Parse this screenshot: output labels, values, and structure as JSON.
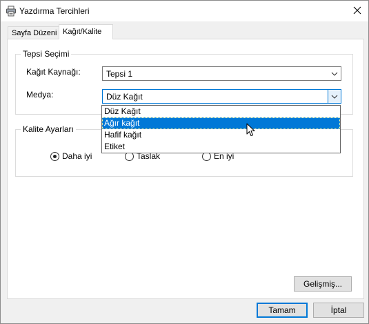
{
  "window": {
    "title": "Yazdırma Tercihleri",
    "icon": "printer-icon",
    "close_icon": "close-icon"
  },
  "tabs": [
    {
      "label": "Sayfa Düzeni",
      "active": false
    },
    {
      "label": "Kağıt/Kalite",
      "active": true
    }
  ],
  "tray_group": {
    "label": "Tepsi Seçimi",
    "source_label": "Kağıt Kaynağı:",
    "source_value": "Tepsi 1",
    "media_label": "Medya:",
    "media_value": "Düz Kağıt",
    "media_options": [
      "Düz Kağıt",
      "Ağır kağıt",
      "Hafif kağıt",
      "Etiket"
    ],
    "highlighted_option": "Ağır kağıt"
  },
  "quality_group": {
    "label": "Kalite Ayarları",
    "options": [
      {
        "label": "Daha iyi",
        "selected": true
      },
      {
        "label": "Taslak",
        "selected": false
      },
      {
        "label": "En iyi",
        "selected": false
      }
    ]
  },
  "buttons": {
    "advanced": "Gelişmiş...",
    "ok": "Tamam",
    "cancel": "İptal"
  },
  "colors": {
    "accent": "#0078d7",
    "selection_text": "#ffffff"
  }
}
